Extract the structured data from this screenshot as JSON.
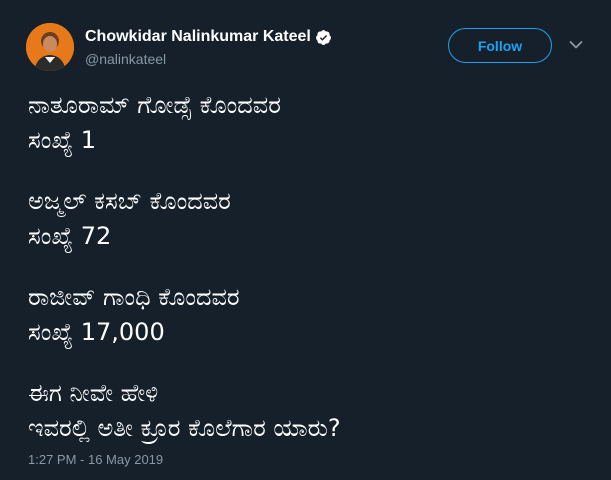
{
  "user": {
    "display_name": "Chowkidar Nalinkumar Kateel",
    "handle": "@nalinkateel",
    "verified_icon": "verified-badge-icon",
    "avatar_icon": "avatar"
  },
  "actions": {
    "follow_label": "Follow",
    "more_icon": "chevron-down-icon"
  },
  "tweet": {
    "paragraphs": [
      {
        "line1": "ನಾತೂರಾಮ್ ಗೋಡ್ಸೆ ಕೊಂದವರ",
        "line2": "ಸಂಖ್ಯೆ 1"
      },
      {
        "line1": "ಅಜ್ಮಲ್ ಕಸಬ್ ಕೊಂದವರ",
        "line2": "ಸಂಖ್ಯೆ 72"
      },
      {
        "line1": "ರಾಜೀವ್ ಗಾಂಧಿ ಕೊಂದವರ",
        "line2": "ಸಂಖ್ಯೆ 17,000"
      },
      {
        "line1": "ಈಗ ನೀವೇ ಹೇಳಿ",
        "line2": "ಇವರಲ್ಲಿ ಅತೀ ಕ್ರೂರ ಕೊಲೆಗಾರ ಯಾರು?"
      }
    ],
    "timestamp": "1:27 PM - 16 May 2019"
  },
  "colors": {
    "background": "#15202b",
    "text": "#ffffff",
    "secondary": "#8899a6",
    "accent": "#1da1f2"
  }
}
